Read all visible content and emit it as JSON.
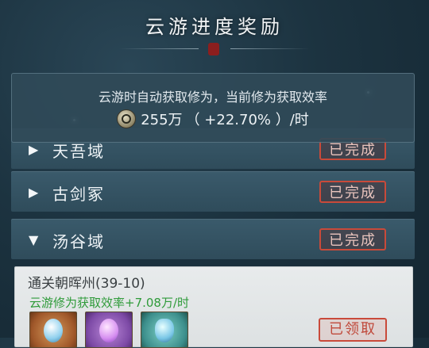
{
  "title": "云游进度奖励",
  "info": {
    "line1": "云游时自动获取修为，当前修为获取效率",
    "value": "255万",
    "rate": "（ +22.70% ）/时"
  },
  "regions": [
    {
      "name": "天吾域",
      "status": "已完成",
      "expanded": false
    },
    {
      "name": "古剑冢",
      "status": "已完成",
      "expanded": false
    },
    {
      "name": "汤谷域",
      "status": "已完成",
      "expanded": true
    }
  ],
  "detail": {
    "stage": "通关朝晖州(39-10)",
    "bonus": "云游修为获取效率+7.08万/时",
    "rewards": [
      "dragon-item",
      "purple-orb-item",
      "crystal-item"
    ],
    "claim_status": "已领取"
  },
  "colors": {
    "accent_red": "#c94a3a",
    "bonus_green": "#2f9b3a"
  }
}
